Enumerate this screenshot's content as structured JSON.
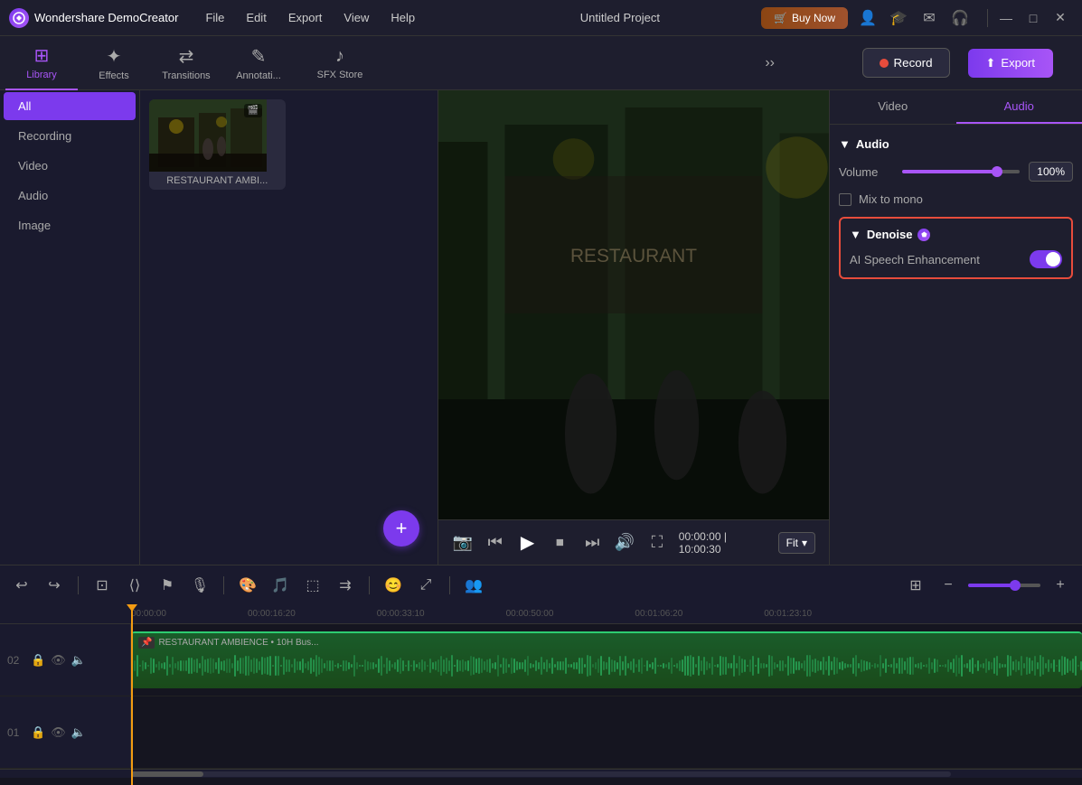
{
  "app": {
    "name": "Wondershare DemoCreator",
    "logo_char": "W"
  },
  "menu": {
    "items": [
      "File",
      "Edit",
      "Export",
      "View",
      "Help"
    ]
  },
  "project": {
    "title": "Untitled Project"
  },
  "window_controls": {
    "minimize": "—",
    "maximize": "□",
    "close": "✕"
  },
  "header": {
    "buy_now": "Buy Now",
    "export_label": "Export",
    "record_label": "Record"
  },
  "tabs": [
    {
      "id": "library",
      "label": "Library",
      "icon": "⊞",
      "active": true
    },
    {
      "id": "effects",
      "label": "Effects",
      "icon": "✦"
    },
    {
      "id": "transitions",
      "label": "Transitions",
      "icon": "⇄"
    },
    {
      "id": "annotations",
      "label": "Annotati...",
      "icon": "✎"
    },
    {
      "id": "sfxstore",
      "label": "SFX Store",
      "icon": "♪"
    }
  ],
  "sidebar": {
    "items": [
      {
        "id": "all",
        "label": "All",
        "active": true
      },
      {
        "id": "recording",
        "label": "Recording"
      },
      {
        "id": "video",
        "label": "Video"
      },
      {
        "id": "audio",
        "label": "Audio"
      },
      {
        "id": "image",
        "label": "Image"
      }
    ]
  },
  "media": {
    "items": [
      {
        "label": "RESTAURANT AMBI..."
      }
    ],
    "add_button": "+"
  },
  "preview": {
    "time_current": "00:00:00",
    "time_total": "10:00:30",
    "fit_label": "Fit"
  },
  "right_panel": {
    "tabs": [
      "Video",
      "Audio"
    ],
    "active_tab": "Audio"
  },
  "audio_settings": {
    "section_label": "Audio",
    "volume_label": "Volume",
    "volume_value": "100%",
    "mix_to_mono_label": "Mix to mono"
  },
  "denoise": {
    "section_label": "Denoise",
    "ai_label": "AI Speech Enhancement",
    "toggle_state": "on"
  },
  "timeline": {
    "rulers": [
      "00:00:00",
      "00:00:16:20",
      "00:00:33:10",
      "00:00:50:00",
      "00:01:06:20",
      "00:01:23:10"
    ],
    "tracks": [
      {
        "num": "02",
        "clip_label": "RESTAURANT AMBIENCE • 10H Bus...",
        "show_clip": true
      },
      {
        "num": "01",
        "clip_label": "",
        "show_clip": false
      }
    ]
  }
}
